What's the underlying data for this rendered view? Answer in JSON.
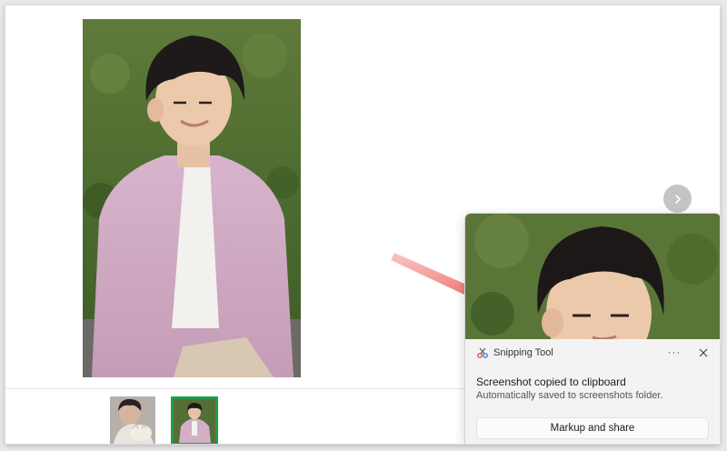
{
  "viewer": {
    "next_icon": "chevron-right-icon",
    "main_photo_alt": "",
    "thumbnails": [
      {
        "name": "thumbnail-1",
        "selected": false
      },
      {
        "name": "thumbnail-2",
        "selected": true
      }
    ],
    "selected_border_color": "#1f9e4a"
  },
  "toast": {
    "app_name": "Snipping Tool",
    "more_label": "···",
    "title": "Screenshot copied to clipboard",
    "subtitle": "Automatically saved to screenshots folder.",
    "action_label": "Markup and share"
  },
  "colors": {
    "arrow": "#e8241c",
    "toast_bg": "#f3f3f3"
  }
}
